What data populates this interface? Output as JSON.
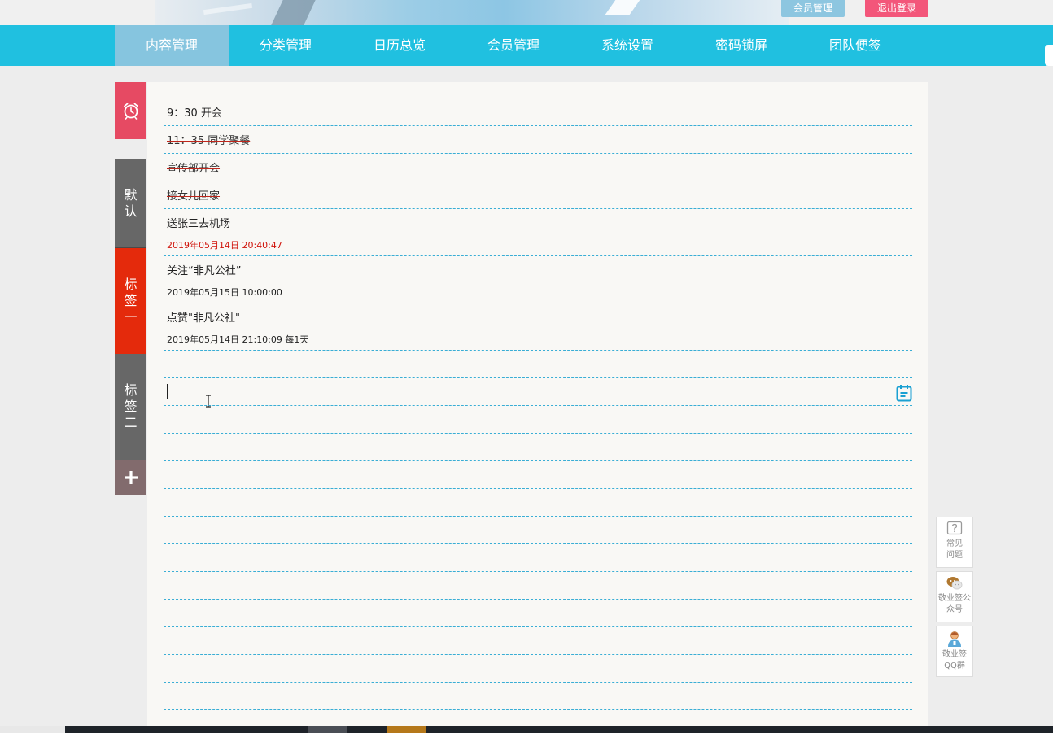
{
  "header": {
    "member_btn": "会员管理",
    "logout_btn": "退出登录"
  },
  "nav": {
    "items": [
      "内容管理",
      "分类管理",
      "日历总览",
      "会员管理",
      "系统设置",
      "密码锁屏",
      "团队便签"
    ],
    "active_index": 0
  },
  "tabs": {
    "alarm_icon": "alarm-clock-icon",
    "default_label": "默认",
    "tag1_label": "标签一",
    "tag2_label": "标签二",
    "add_icon": "plus-icon"
  },
  "notes": [
    {
      "text": "9：30 开会",
      "done": false
    },
    {
      "text": "11：35 同学聚餐",
      "done": true
    },
    {
      "text": "宣传部开会",
      "done": true
    },
    {
      "text": "接女儿回家",
      "done": true
    },
    {
      "text": "送张三去机场",
      "done": false,
      "time": "2019年05月14日 20:40:47",
      "time_red": true
    },
    {
      "text": "关注“非凡公社”",
      "done": false,
      "time": "2019年05月15日 10:00:00"
    },
    {
      "text": "点赞\"非凡公社\"",
      "done": false,
      "time": "2019年05月14日 21:10:09 每1天"
    }
  ],
  "editor": {
    "value": "",
    "calendar_icon": "calendar-icon"
  },
  "float": {
    "faq": "常见问题",
    "wechat": "敬业签公众号",
    "qq": "敬业签QQ群"
  },
  "colors": {
    "nav_bg": "#20c0e0",
    "nav_active": "#86c5df",
    "logout": "#f3567a",
    "tab_alarm": "#e64a63",
    "tab_active": "#e42a0c",
    "tab_gray": "#676767",
    "line": "#3aaed5",
    "time_red": "#d0140b"
  }
}
